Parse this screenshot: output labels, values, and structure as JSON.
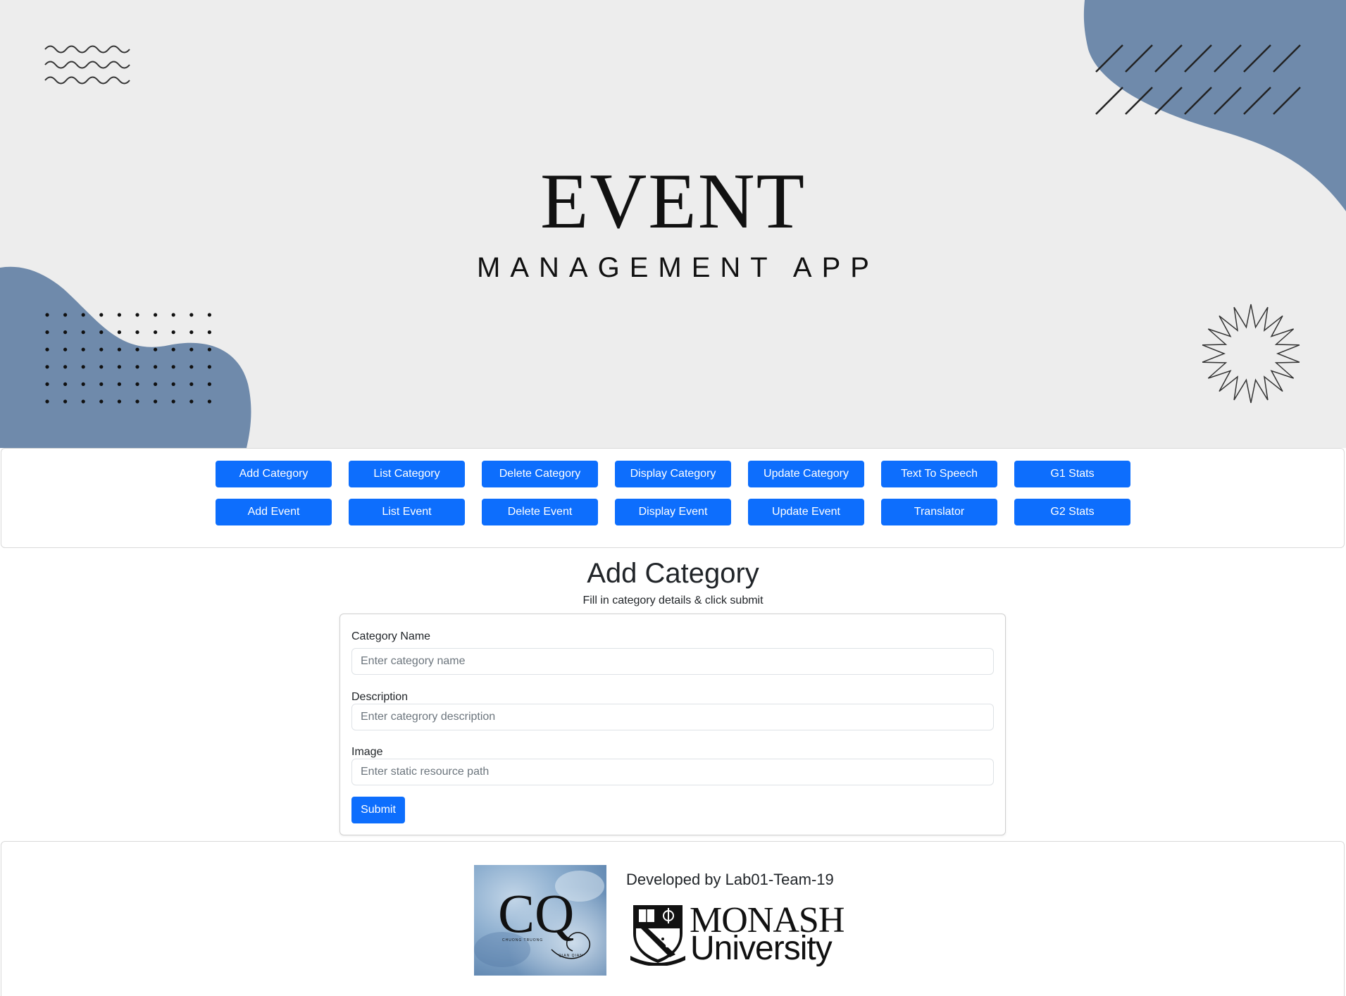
{
  "hero": {
    "title": "EVENT",
    "subtitle": "MANAGEMENT APP",
    "accent_color": "#6f8aab",
    "background_color": "#ededed"
  },
  "nav": {
    "buttons": [
      "Add Category",
      "List Category",
      "Delete Category",
      "Display Category",
      "Update Category",
      "Text To Speech",
      "G1 Stats",
      "Add Event",
      "List Event",
      "Delete Event",
      "Display Event",
      "Update Event",
      "Translator",
      "G2 Stats"
    ],
    "button_color": "#0d6efd"
  },
  "page": {
    "title": "Add Category",
    "subtitle": "Fill in category details & click submit"
  },
  "form": {
    "category_name": {
      "label": "Category Name",
      "value": "",
      "placeholder": "Enter category name"
    },
    "description": {
      "label": "Description",
      "value": "",
      "placeholder": "Enter categrory description"
    },
    "image": {
      "label": "Image",
      "value": "",
      "placeholder": "Enter static resource path"
    },
    "submit_label": "Submit"
  },
  "footer": {
    "credit": "Developed by Lab01-Team-19",
    "university_name": "MONASH",
    "university_suffix": "University",
    "team_logo_text": "CQ",
    "team_logo_small_left": "CHUONG TRUONG",
    "team_logo_small_right": "QIAN QIAN"
  }
}
